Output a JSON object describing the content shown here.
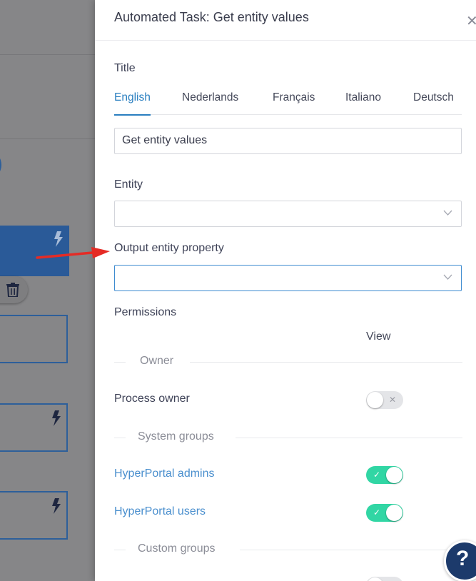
{
  "drawer": {
    "title": "Automated Task: Get entity values",
    "close_icon": "close-icon"
  },
  "title_section": {
    "label": "Title",
    "tabs": [
      {
        "label": "English",
        "active": true
      },
      {
        "label": "Nederlands",
        "active": false
      },
      {
        "label": "Français",
        "active": false
      },
      {
        "label": "Italiano",
        "active": false
      },
      {
        "label": "Deutsch",
        "active": false
      }
    ],
    "value": "Get entity values"
  },
  "entity": {
    "label": "Entity",
    "value": ""
  },
  "output_property": {
    "label": "Output entity property",
    "value": ""
  },
  "permissions": {
    "label": "Permissions",
    "column": "View",
    "groups": [
      {
        "name": "Owner",
        "rows": [
          {
            "label": "Process owner",
            "view": false
          }
        ]
      },
      {
        "name": "System groups",
        "rows": [
          {
            "label": "HyperPortal admins",
            "view": true
          },
          {
            "label": "HyperPortal users",
            "view": true
          }
        ]
      },
      {
        "name": "Custom groups",
        "rows": []
      }
    ]
  },
  "toggle_marks": {
    "on": "✓",
    "off": "✕"
  },
  "help": {
    "glyph": "?"
  },
  "colors": {
    "accent": "#2a7fc0",
    "toggle_on": "#31d6a4",
    "help_button": "#1c3a6b",
    "annotation_arrow": "#e52b25"
  }
}
